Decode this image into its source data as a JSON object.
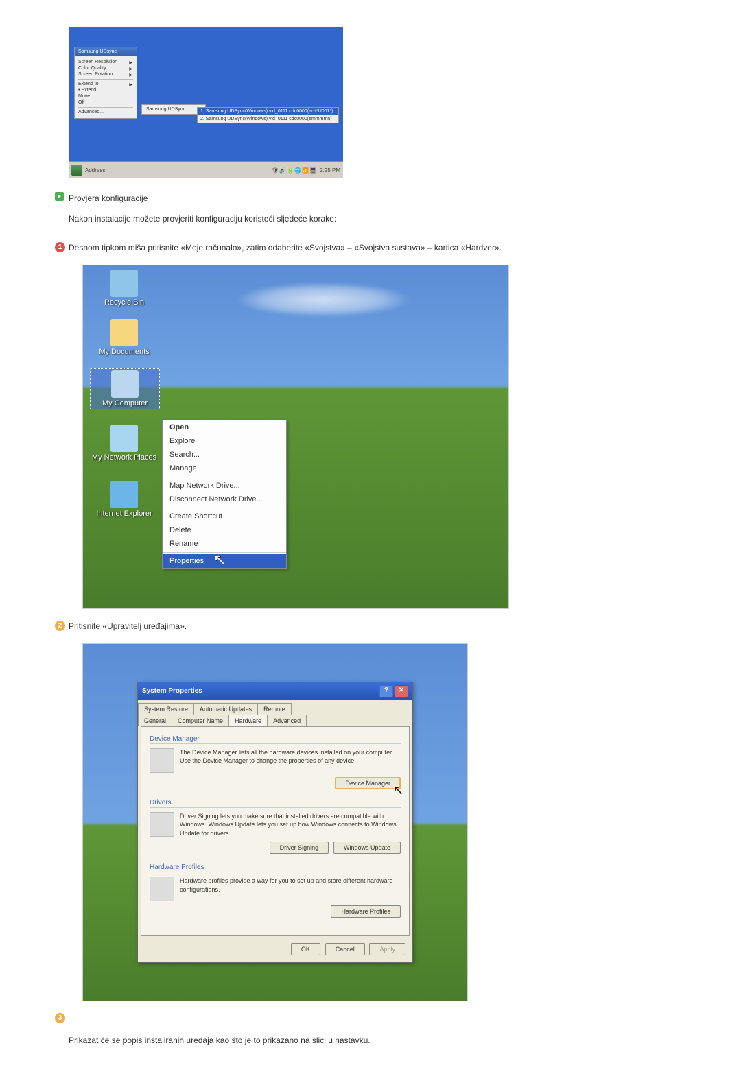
{
  "screenshot1": {
    "menu_title": "Samsung UDsync",
    "items": [
      "Screen Resolution",
      "Color Quality",
      "Screen Rotation"
    ],
    "items2": [
      "Extend to",
      "Extend",
      "Move",
      "Off"
    ],
    "items3": "Advanced...",
    "sub1": "Samsung UDSync",
    "sub2_sel": "1. Samsung UDSync(Windows) vid_0111 cdc0000(ar*t*U001*)",
    "sub2_unsel": "2. Samsung UDSync(Windows) vid_0111 cdc0000(emmmmn)",
    "taskbar_addr": "Address",
    "taskbar_time": "2:25 PM"
  },
  "section_check_title": "Provjera konfiguracije",
  "section_check_desc": "Nakon instalacije možete provjeriti konfiguraciju koristeći sljedeće korake:",
  "step1": "Desnom tipkom miša pritisnite «Moje računalo», zatim odaberite «Svojstva» – «Svojstva sustava» – kartica «Hardver».",
  "step2": "Pritisnite «Upravitelj uređajima».",
  "step3": "Prikazat će se popis instaliranih uređaja kao što je to prikazano na slici u nastavku.",
  "desktop_icons": [
    "Recycle Bin",
    "My Documents",
    "My Computer",
    "My Network Places",
    "Internet Explorer"
  ],
  "ctx_items": {
    "open": "Open",
    "explore": "Explore",
    "search": "Search...",
    "manage": "Manage",
    "map": "Map Network Drive...",
    "disconnect": "Disconnect Network Drive...",
    "shortcut": "Create Shortcut",
    "delete": "Delete",
    "rename": "Rename",
    "properties": "Properties"
  },
  "sysprop": {
    "title": "System Properties",
    "tabs_top": [
      "System Restore",
      "Automatic Updates",
      "Remote"
    ],
    "tabs_bottom": [
      "General",
      "Computer Name",
      "Hardware",
      "Advanced"
    ],
    "dm_title": "Device Manager",
    "dm_text": "The Device Manager lists all the hardware devices installed on your computer. Use the Device Manager to change the properties of any device.",
    "dm_btn": "Device Manager",
    "drv_title": "Drivers",
    "drv_text": "Driver Signing lets you make sure that installed drivers are compatible with Windows. Windows Update lets you set up how Windows connects to Windows Update for drivers.",
    "drv_btn1": "Driver Signing",
    "drv_btn2": "Windows Update",
    "hp_title": "Hardware Profiles",
    "hp_text": "Hardware profiles provide a way for you to set up and store different hardware configurations.",
    "hp_btn": "Hardware Profiles",
    "ok": "OK",
    "cancel": "Cancel",
    "apply": "Apply"
  }
}
